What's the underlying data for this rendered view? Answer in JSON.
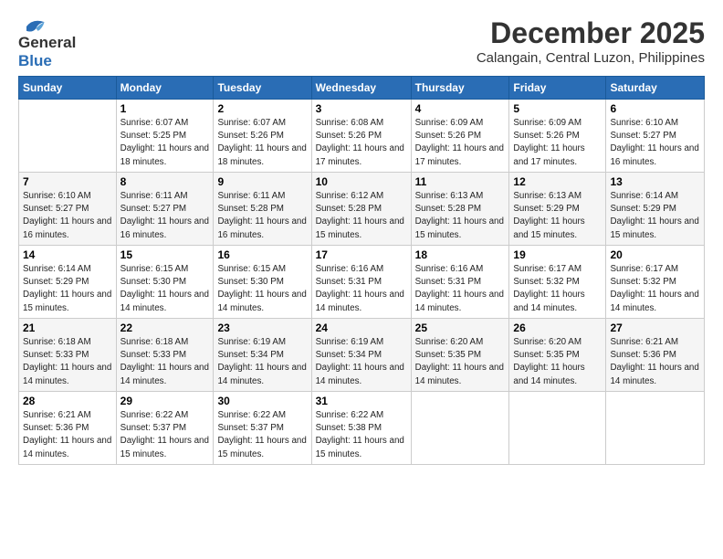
{
  "header": {
    "logo_line1": "General",
    "logo_line2": "Blue",
    "month": "December 2025",
    "location": "Calangain, Central Luzon, Philippines"
  },
  "weekdays": [
    "Sunday",
    "Monday",
    "Tuesday",
    "Wednesday",
    "Thursday",
    "Friday",
    "Saturday"
  ],
  "weeks": [
    [
      {
        "day": "",
        "sunrise": "",
        "sunset": "",
        "daylight": ""
      },
      {
        "day": "1",
        "sunrise": "6:07 AM",
        "sunset": "5:25 PM",
        "daylight": "11 hours and 18 minutes."
      },
      {
        "day": "2",
        "sunrise": "6:07 AM",
        "sunset": "5:26 PM",
        "daylight": "11 hours and 18 minutes."
      },
      {
        "day": "3",
        "sunrise": "6:08 AM",
        "sunset": "5:26 PM",
        "daylight": "11 hours and 17 minutes."
      },
      {
        "day": "4",
        "sunrise": "6:09 AM",
        "sunset": "5:26 PM",
        "daylight": "11 hours and 17 minutes."
      },
      {
        "day": "5",
        "sunrise": "6:09 AM",
        "sunset": "5:26 PM",
        "daylight": "11 hours and 17 minutes."
      },
      {
        "day": "6",
        "sunrise": "6:10 AM",
        "sunset": "5:27 PM",
        "daylight": "11 hours and 16 minutes."
      }
    ],
    [
      {
        "day": "7",
        "sunrise": "6:10 AM",
        "sunset": "5:27 PM",
        "daylight": "11 hours and 16 minutes."
      },
      {
        "day": "8",
        "sunrise": "6:11 AM",
        "sunset": "5:27 PM",
        "daylight": "11 hours and 16 minutes."
      },
      {
        "day": "9",
        "sunrise": "6:11 AM",
        "sunset": "5:28 PM",
        "daylight": "11 hours and 16 minutes."
      },
      {
        "day": "10",
        "sunrise": "6:12 AM",
        "sunset": "5:28 PM",
        "daylight": "11 hours and 15 minutes."
      },
      {
        "day": "11",
        "sunrise": "6:13 AM",
        "sunset": "5:28 PM",
        "daylight": "11 hours and 15 minutes."
      },
      {
        "day": "12",
        "sunrise": "6:13 AM",
        "sunset": "5:29 PM",
        "daylight": "11 hours and 15 minutes."
      },
      {
        "day": "13",
        "sunrise": "6:14 AM",
        "sunset": "5:29 PM",
        "daylight": "11 hours and 15 minutes."
      }
    ],
    [
      {
        "day": "14",
        "sunrise": "6:14 AM",
        "sunset": "5:29 PM",
        "daylight": "11 hours and 15 minutes."
      },
      {
        "day": "15",
        "sunrise": "6:15 AM",
        "sunset": "5:30 PM",
        "daylight": "11 hours and 14 minutes."
      },
      {
        "day": "16",
        "sunrise": "6:15 AM",
        "sunset": "5:30 PM",
        "daylight": "11 hours and 14 minutes."
      },
      {
        "day": "17",
        "sunrise": "6:16 AM",
        "sunset": "5:31 PM",
        "daylight": "11 hours and 14 minutes."
      },
      {
        "day": "18",
        "sunrise": "6:16 AM",
        "sunset": "5:31 PM",
        "daylight": "11 hours and 14 minutes."
      },
      {
        "day": "19",
        "sunrise": "6:17 AM",
        "sunset": "5:32 PM",
        "daylight": "11 hours and 14 minutes."
      },
      {
        "day": "20",
        "sunrise": "6:17 AM",
        "sunset": "5:32 PM",
        "daylight": "11 hours and 14 minutes."
      }
    ],
    [
      {
        "day": "21",
        "sunrise": "6:18 AM",
        "sunset": "5:33 PM",
        "daylight": "11 hours and 14 minutes."
      },
      {
        "day": "22",
        "sunrise": "6:18 AM",
        "sunset": "5:33 PM",
        "daylight": "11 hours and 14 minutes."
      },
      {
        "day": "23",
        "sunrise": "6:19 AM",
        "sunset": "5:34 PM",
        "daylight": "11 hours and 14 minutes."
      },
      {
        "day": "24",
        "sunrise": "6:19 AM",
        "sunset": "5:34 PM",
        "daylight": "11 hours and 14 minutes."
      },
      {
        "day": "25",
        "sunrise": "6:20 AM",
        "sunset": "5:35 PM",
        "daylight": "11 hours and 14 minutes."
      },
      {
        "day": "26",
        "sunrise": "6:20 AM",
        "sunset": "5:35 PM",
        "daylight": "11 hours and 14 minutes."
      },
      {
        "day": "27",
        "sunrise": "6:21 AM",
        "sunset": "5:36 PM",
        "daylight": "11 hours and 14 minutes."
      }
    ],
    [
      {
        "day": "28",
        "sunrise": "6:21 AM",
        "sunset": "5:36 PM",
        "daylight": "11 hours and 14 minutes."
      },
      {
        "day": "29",
        "sunrise": "6:22 AM",
        "sunset": "5:37 PM",
        "daylight": "11 hours and 15 minutes."
      },
      {
        "day": "30",
        "sunrise": "6:22 AM",
        "sunset": "5:37 PM",
        "daylight": "11 hours and 15 minutes."
      },
      {
        "day": "31",
        "sunrise": "6:22 AM",
        "sunset": "5:38 PM",
        "daylight": "11 hours and 15 minutes."
      },
      {
        "day": "",
        "sunrise": "",
        "sunset": "",
        "daylight": ""
      },
      {
        "day": "",
        "sunrise": "",
        "sunset": "",
        "daylight": ""
      },
      {
        "day": "",
        "sunrise": "",
        "sunset": "",
        "daylight": ""
      }
    ]
  ]
}
